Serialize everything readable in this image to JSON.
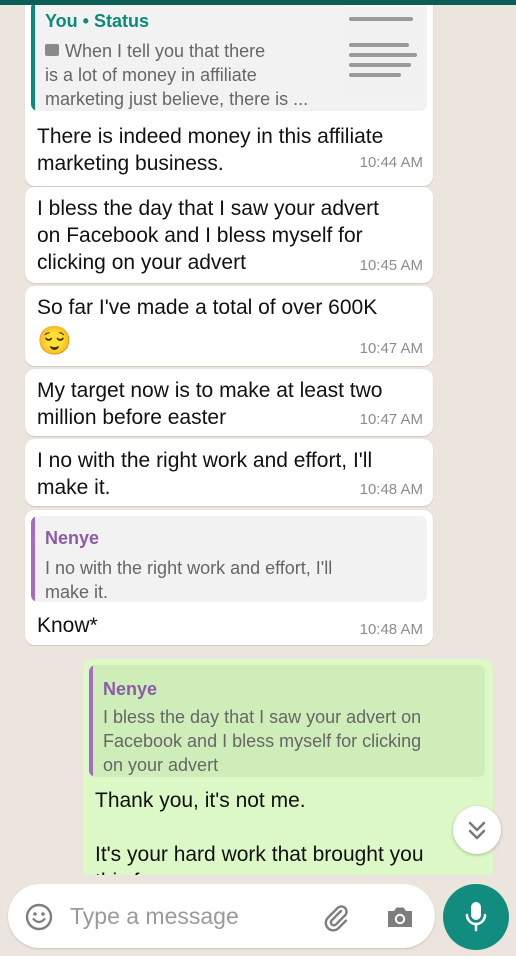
{
  "colors": {
    "chat_bg": "#ECE5DD",
    "incoming_bubble": "#FFFFFF",
    "outgoing_bubble": "#DCF8C6",
    "quote_you_name": "#0B8A7A",
    "quote_nenye_name": "#8B5CA8",
    "quote_nenye_bar": "#A56CC1",
    "mic_button": "#128C7E"
  },
  "messages": [
    {
      "quote": {
        "name": "You • Status",
        "text": "When I tell you that there\nis a lot of money in affiliate\nmarketing just believe, there is ...",
        "icon": "image-icon"
      },
      "text": "There is indeed money in this affiliate\nmarketing business.",
      "time": "10:44 AM"
    },
    {
      "text": "I bless the day that I saw your advert\non Facebook and I bless myself for\nclicking on your advert",
      "time": "10:45 AM"
    },
    {
      "text": "So far I've made a total of over 600K",
      "emoji": "😌",
      "time": "10:47 AM"
    },
    {
      "text": "My target now is to make at least two\nmillion before easter",
      "time": "10:47 AM"
    },
    {
      "text": "I no with the right work and effort, I'll\nmake it.",
      "time": "10:48 AM"
    },
    {
      "quote": {
        "name": "Nenye",
        "text": "I no with the right work and effort, I'll\nmake it."
      },
      "text": "Know*",
      "time": "10:48 AM"
    },
    {
      "quote": {
        "name": "Nenye",
        "text": "I bless the day that I saw your advert on\nFacebook and I bless myself for clicking\non your advert"
      },
      "text": "Thank you, it's not me.\n\nIt's your hard work that brought you\nthis far"
    }
  ],
  "input": {
    "placeholder": "Type a message",
    "icons": [
      "emoji-icon",
      "attach-icon",
      "camera-icon",
      "mic-icon"
    ]
  },
  "scroll_button_icon": "double-chevron-down-icon"
}
